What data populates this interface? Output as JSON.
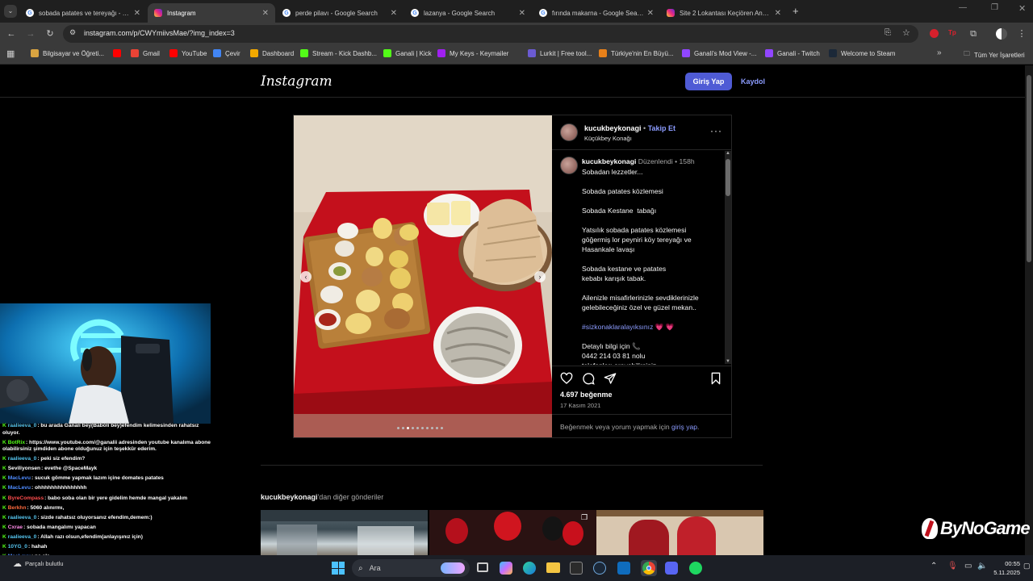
{
  "browser": {
    "tabs": [
      {
        "label": "sobada patates ve tereyağı - Go",
        "icon": "google-icon"
      },
      {
        "label": "Instagram",
        "icon": "instagram-icon",
        "active": true
      },
      {
        "label": "perde pilavı - Google Search",
        "icon": "google-icon"
      },
      {
        "label": "lazanya - Google Search",
        "icon": "google-icon"
      },
      {
        "label": "fırında makarna - Google Search",
        "icon": "google-icon"
      },
      {
        "label": "Site 2 Lokantası Keçiören Ankara",
        "icon": "instagram-icon"
      }
    ],
    "url": "instagram.com/p/CWYmiivsMae/?img_index=3",
    "bookmarks": [
      {
        "label": "Bilgisayar ve Öğreti...",
        "color": "#d9a441"
      },
      {
        "label": "",
        "color": "#ff0000"
      },
      {
        "label": "Gmail",
        "color": "#ea4335"
      },
      {
        "label": "YouTube",
        "color": "#ff0000"
      },
      {
        "label": "Çevir",
        "color": "#4285f4"
      },
      {
        "label": "Dashboard",
        "color": "#f2a900"
      },
      {
        "label": "Stream - Kick Dashb...",
        "color": "#53fc18"
      },
      {
        "label": "Ganali | Kick",
        "color": "#53fc18"
      },
      {
        "label": "My Keys - Keymailer",
        "color": "#a020f0"
      },
      {
        "label": "Lurkit | Free tool...",
        "color": "#6b5bd2"
      },
      {
        "label": "Türkiye'nin En Büyü...",
        "color": "#e8811a"
      },
      {
        "label": "Ganali's Mod View -...",
        "color": "#9146ff"
      },
      {
        "label": "Ganali - Twitch",
        "color": "#9146ff"
      },
      {
        "label": "Welcome to Steam",
        "color": "#1b2838"
      }
    ],
    "all_bookmarks": "Tüm Yer İşaretleri"
  },
  "instagram": {
    "logo": "Instagram",
    "login": "Giriş Yap",
    "signup": "Kaydol",
    "post": {
      "username": "kucukbeykonagi",
      "follow": "Takip Et",
      "location": "Küçükbey Konağı",
      "edited": "Düzenlendi",
      "age": "158h",
      "caption_lines": [
        "Sobadan lezzetler...",
        "",
        "Sobada patates közlemesi",
        "",
        "Sobada Kestane  tabağı",
        "",
        "Yatsılık sobada patates közlemesi",
        "göğermiş lor peyniri köy tereyağı ve",
        "Hasankale lavaşı",
        "",
        "Sobada kestane ve patates",
        "kebabı karışık tabak.",
        "",
        "Ailenizle misafirlerinizle sevdiklerinizle",
        "gelebileceğiniz özel ve güzel mekan..",
        "",
        "#sizkonaklaralayıksınız 💗 💗",
        "",
        "Detaylı bilgi için 📞",
        "0442 214 03 81 nolu",
        "telefonları arayabilirsiniz"
      ],
      "likes": "4.697 beğenme",
      "date": "17 Kasım 2021",
      "login_prompt_prefix": "Beğenmek veya yorum yapmak için",
      "login_prompt_link": "giriş yap",
      "login_prompt_suffix": "."
    },
    "more_posts_user": "kucukbeykonagi",
    "more_posts_suffix": "'dan diğer gönderiler"
  },
  "stream": {
    "chat": [
      {
        "user": "raalieeva_0",
        "color": "#56c6f0",
        "msg": ": bu arada Ganali bey(Baboli bey)efendim kelimesinden rahatsız oluyor."
      },
      {
        "user": "BotRix",
        "color": "#53fc18",
        "msg": ": https://www.youtube.com/@ganalii adresinden youtube kanalıma abone olabilirsiniz şimdiden abone olduğunuz için teşekkür ederim."
      },
      {
        "user": "raalieeva_0",
        "color": "#56c6f0",
        "msg": ": peki siz efendim?"
      },
      {
        "user": "Seviliyonsen",
        "color": "#ffffff",
        "msg": ": evethe @SpaceMayk"
      },
      {
        "user": "MacLevu",
        "color": "#4f8cff",
        "msg": ": sucuk gömme yapmak lazım içine domates patates"
      },
      {
        "user": "MacLevu",
        "color": "#4f8cff",
        "msg": ": ohhhhhhhhhhhhhhh"
      },
      {
        "user": "ByreCompass",
        "color": "#ff4d4d",
        "msg": ": babo soba olan bir yere gidelim hemde mangal yakalım"
      },
      {
        "user": "Berkhn",
        "color": "#ff6a3d",
        "msg": ": 5060 alınırmı,"
      },
      {
        "user": "raalieeva_0",
        "color": "#56c6f0",
        "msg": ": sizde rahatsız oluyorsanız efendim,demem:)"
      },
      {
        "user": "Cxrae",
        "color": "#ff8be8",
        "msg": ": sobada mangalımı yapacan"
      },
      {
        "user": "raalieeva_0",
        "color": "#56c6f0",
        "msg": ": Allah razı olsun,efendim(anlayışınız için)"
      },
      {
        "user": "10YG_0",
        "color": "#56c6f0",
        "msg": ": hahah"
      },
      {
        "user": "MacLevu",
        "color": "#4f8cff",
        "msg": ": ne,ale"
      }
    ],
    "watermark": "ByNoGame"
  },
  "taskbar": {
    "search_placeholder": "Ara",
    "weather_text": "Parçalı bulutlu",
    "time": "00:55",
    "date": "5.11.2025"
  }
}
